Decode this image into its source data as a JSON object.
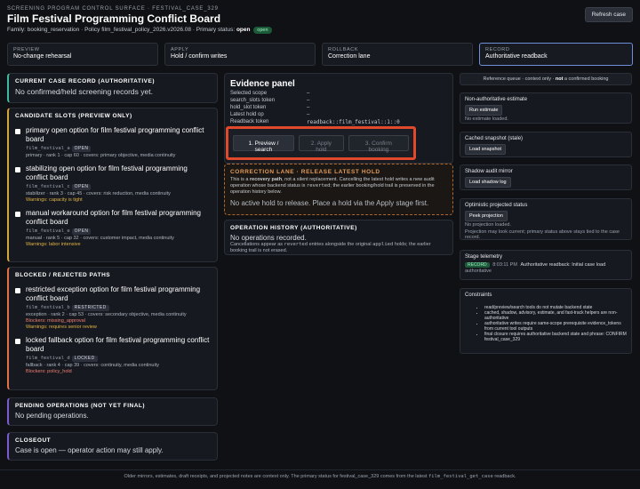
{
  "header": {
    "eyebrow": "SCREENING PROGRAM CONTROL SURFACE · FESTIVAL_CASE_329",
    "title": "Film Festival Programming Conflict Board",
    "meta_prefix": "Family: booking_reservation · Policy film_festival_policy_2026.v2026.08 · Primary status:",
    "status": "open",
    "status_pill": "open",
    "refresh_label": "Refresh case"
  },
  "stages": [
    {
      "label": "PREVIEW",
      "value": "No-change rehearsal"
    },
    {
      "label": "APPLY",
      "value": "Hold / confirm writes"
    },
    {
      "label": "ROLLBACK",
      "value": "Correction lane"
    },
    {
      "label": "RECORD",
      "value": "Authoritative readback"
    }
  ],
  "current_record": {
    "title": "CURRENT CASE RECORD (AUTHORITATIVE)",
    "text": "No confirmed/held screening records yet."
  },
  "candidates": {
    "title": "CANDIDATE SLOTS (PREVIEW ONLY)",
    "items": [
      {
        "title": "primary open option for film festival programming conflict board",
        "id": "film_festival_a",
        "badge": "OPEN",
        "desc": "primary · rank 1 · cap 60 · covers: primary objective, media continuity",
        "warn": ""
      },
      {
        "title": "stabilizing open option for film festival programming conflict board",
        "id": "film_festival_c",
        "badge": "OPEN",
        "desc": "stabilizer · rank 3 · cap 45 · covers: risk reduction, media continuity",
        "warn": "Warnings: capacity is tight"
      },
      {
        "title": "manual workaround option for film festival programming conflict board",
        "id": "film_festival_e",
        "badge": "OPEN",
        "desc": "manual · rank 5 · cap 32 · covers: customer impact, media continuity",
        "warn": "Warnings: labor intensive"
      }
    ]
  },
  "blocked": {
    "title": "BLOCKED / REJECTED PATHS",
    "items": [
      {
        "title": "restricted exception option for film festival programming conflict board",
        "id": "film_festival_b",
        "badge": "RESTRICTED",
        "desc": "exception · rank 2 · cap 53 · covers: secondary objective, media continuity",
        "blockers": "Blockers: missing_approval",
        "warn": "Warnings: requires senior review"
      },
      {
        "title": "locked fallback option for film festival programming conflict board",
        "id": "film_festival_d",
        "badge": "LOCKED",
        "desc": "fallback · rank 4 · cap 39 · covers: continuity, media continuity",
        "blockers": "Blockers: policy_hold",
        "warn": ""
      }
    ]
  },
  "pending": {
    "title": "PENDING OPERATIONS (NOT YET FINAL)",
    "text": "No pending operations."
  },
  "closeout": {
    "title": "CLOSEOUT",
    "text": "Case is open — operator action may still apply."
  },
  "evidence": {
    "title": "Evidence panel",
    "rows": [
      {
        "k": "Selected scope",
        "v": "–"
      },
      {
        "k": "search_slots token",
        "v": "–"
      },
      {
        "k": "hold_slot token",
        "v": "–"
      },
      {
        "k": "Latest hold op",
        "v": "–"
      },
      {
        "k": "Readback token",
        "v": "readback::film_festival::1::0"
      }
    ],
    "actions": {
      "preview": "1. Preview / search",
      "apply": "2. Apply hold",
      "confirm": "3. Confirm booking"
    }
  },
  "correction": {
    "title": "CORRECTION LANE · RELEASE LATEST HOLD",
    "p1_a": "This is a ",
    "p1_b": "recovery path",
    "p1_c": ", not a silent replacement. Cancelling the latest hold writes a new audit operation whose backend status is ",
    "p1_d": "reverted",
    "p1_e": "; the earlier booking/hold trail is preserved in the operation history below.",
    "note": "No active hold to release. Place a hold via the Apply stage first."
  },
  "ophist": {
    "title": "OPERATION HISTORY (AUTHORITATIVE)",
    "text": "No operations recorded.",
    "note_a": "Cancellations appear as ",
    "note_b": "reverted",
    "note_c": " entries alongside the original ",
    "note_d": "applied",
    "note_e": " holds; the earlier booking trail is not erased."
  },
  "right": {
    "ref_queue_a": "Reference queue · context only · ",
    "ref_queue_b": "not",
    "ref_queue_c": " a confirmed booking",
    "estimate": {
      "title": "Non-authoritative estimate",
      "btn": "Run estimate",
      "sub": "No estimate loaded."
    },
    "snapshot": {
      "title": "Cached snapshot (stale)",
      "btn": "Load snapshot"
    },
    "shadow": {
      "title": "Shadow audit mirror",
      "btn": "Load shadow log"
    },
    "optimistic": {
      "title": "Optimistic projected status",
      "btn": "Peek projection",
      "sub1": "No projection loaded.",
      "sub2": "Projection may look current; primary status above stays tied to the case record."
    },
    "telemetry": {
      "title": "Stage telemetry",
      "badge": "RECORD",
      "time": "8:03:11 PM",
      "text": "Authoritative readback: Initial case load",
      "sub": "authoritative"
    },
    "constraints": {
      "title": "Constraints",
      "items": [
        "read/preview/search tools do not mutate backend state",
        "cached, shadow, advisory, estimate, and fast-track helpers are non-authoritative",
        "authoritative writes require same-scope prerequisite evidence_tokens from current tool outputs",
        "final closure requires authoritative backend state and phrase: CONFIRM festival_case_329"
      ]
    }
  },
  "footer": {
    "a": "Older mirrors, estimates, draft receipts, and projected notes are context only. The primary status for festival_case_329 comes from the latest ",
    "b": "film_festival_get_case",
    "c": " readback."
  }
}
